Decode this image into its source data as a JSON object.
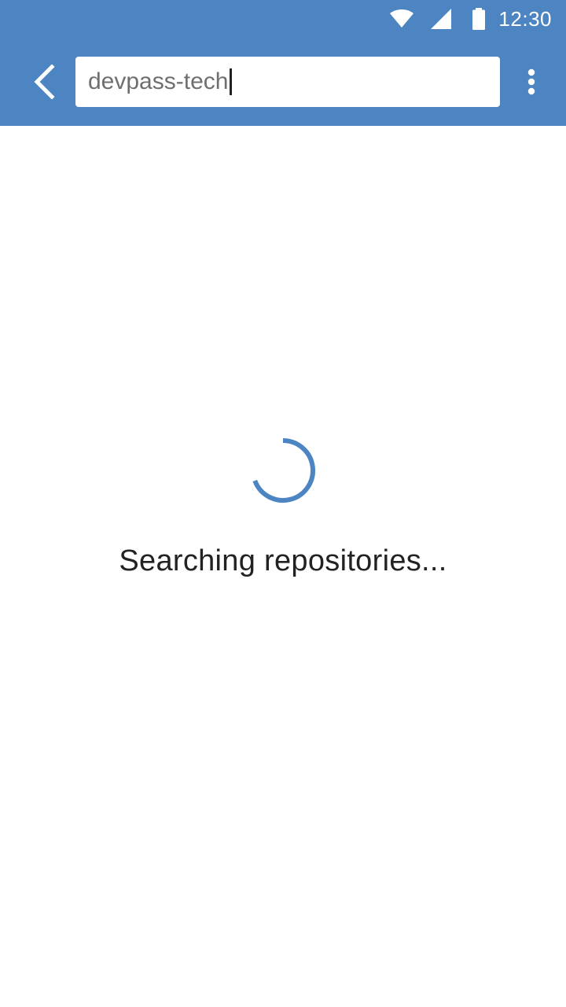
{
  "status_bar": {
    "time": "12:30",
    "icons": [
      "wifi-icon",
      "cell-signal-icon",
      "battery-icon"
    ]
  },
  "toolbar": {
    "back_icon": "chevron-left-icon",
    "search_value": "devpass-tech",
    "overflow_icon": "more-vert-icon"
  },
  "loading": {
    "message": "Searching repositories..."
  },
  "colors": {
    "primary": "#4d84c2",
    "spinner": "#4d84c2",
    "background": "#ffffff",
    "text": "#222222"
  }
}
